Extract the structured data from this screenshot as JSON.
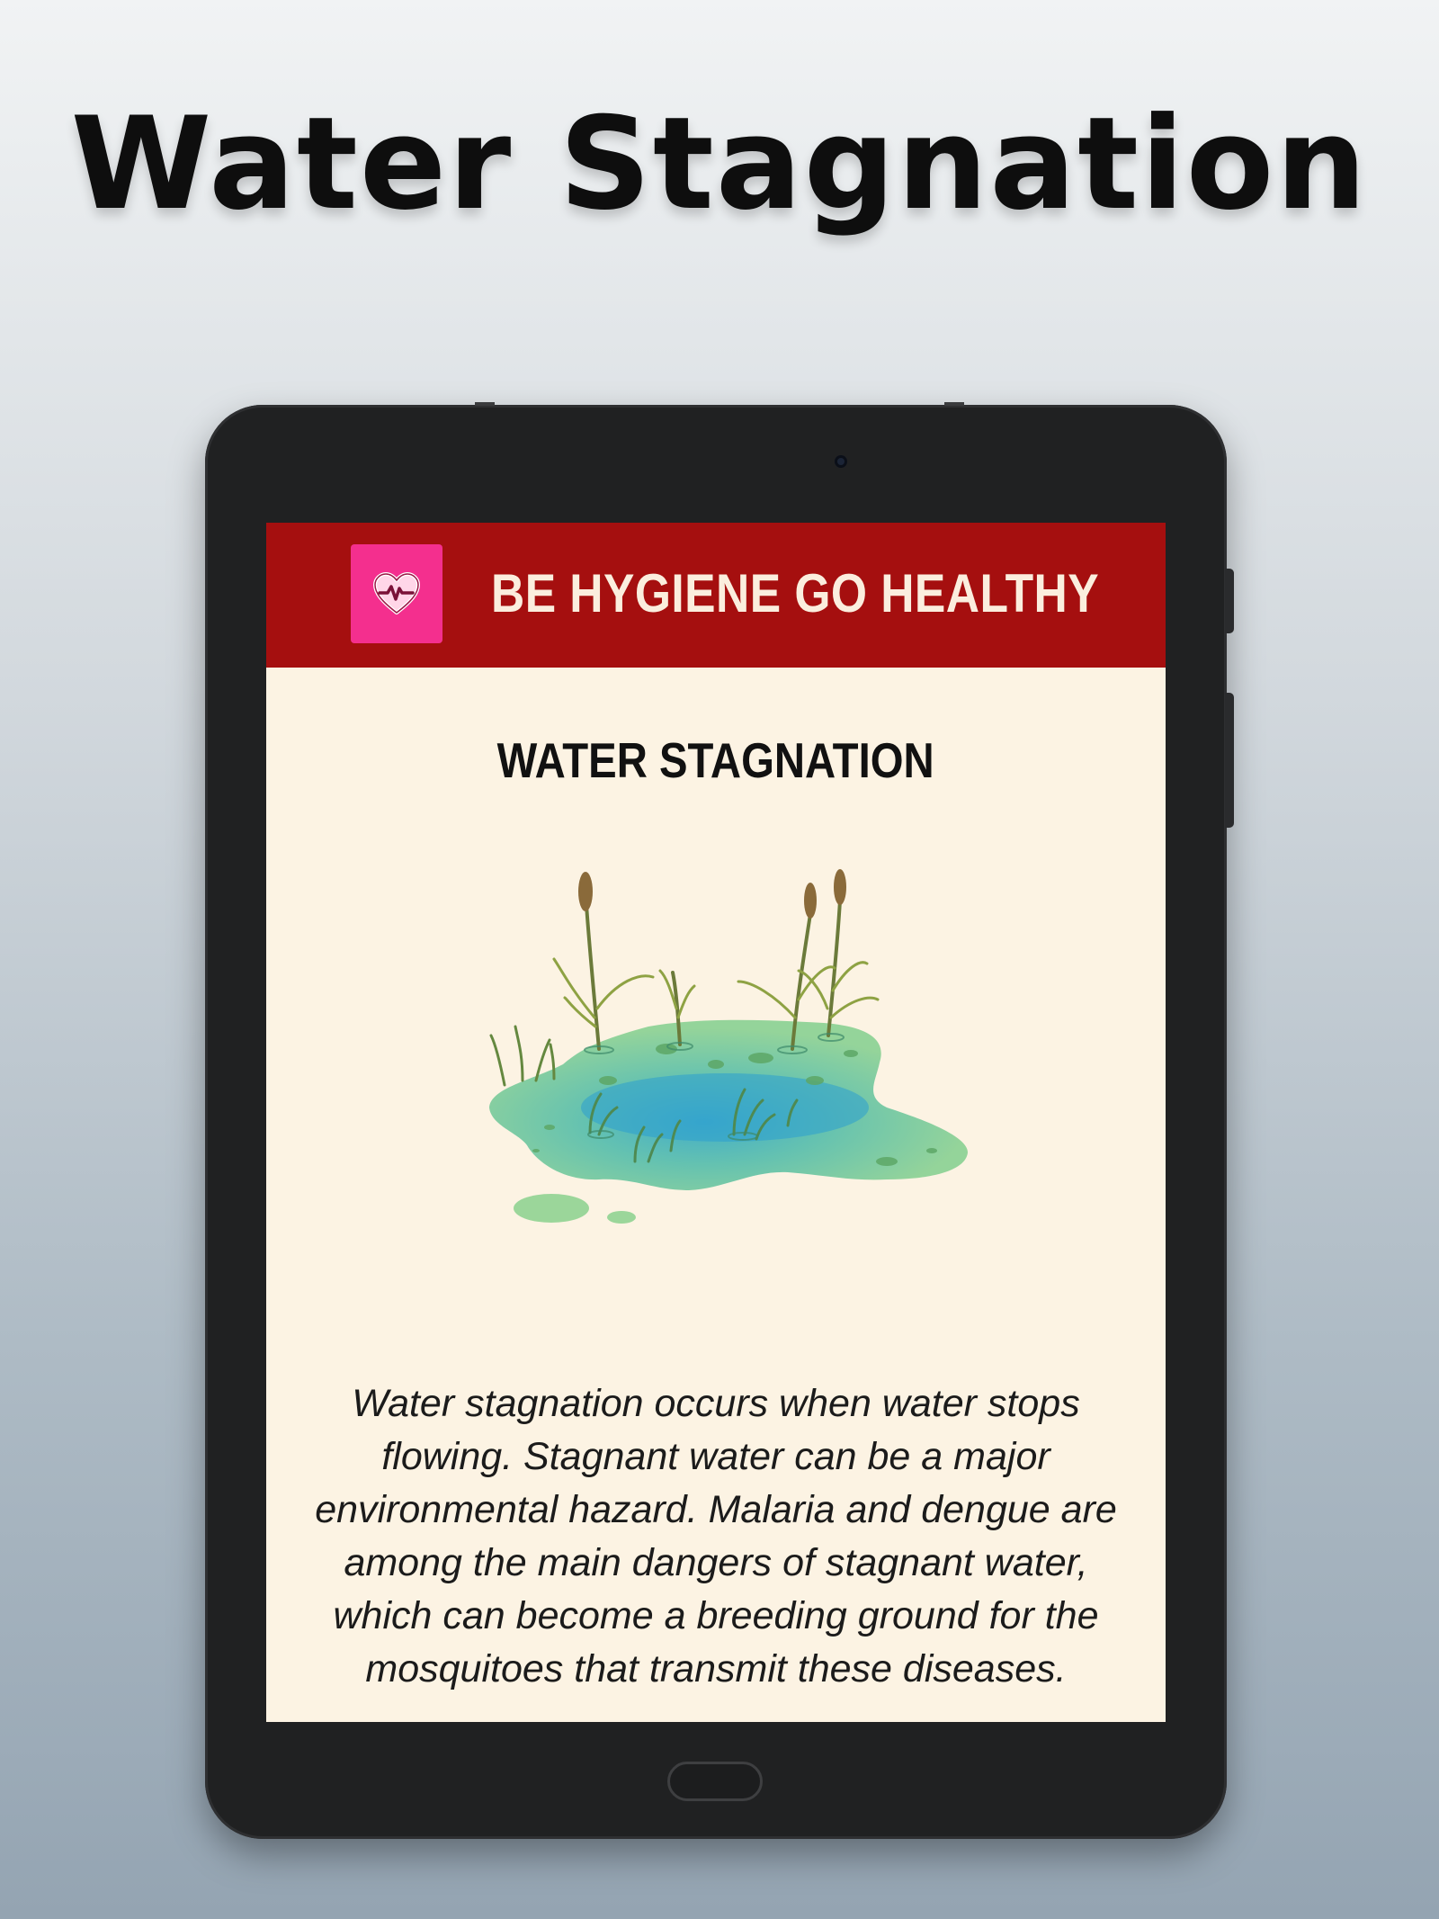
{
  "promo": {
    "title": "Water Stagnation"
  },
  "app_bar": {
    "icon": "heart-pulse-icon",
    "title": "BE HYGIENE GO HEALTHY",
    "background_color": "#a50f0f",
    "icon_color": "#f42f8e"
  },
  "content": {
    "heading": "WATER STAGNATION",
    "image": "stagnant-pond-illustration",
    "description": "Water stagnation occurs when water stops flowing. Stagnant water can be a major environmental hazard. Malaria and dengue are among the main dangers of stagnant water, which can become a breeding ground for the mosquitoes that transmit these diseases."
  }
}
